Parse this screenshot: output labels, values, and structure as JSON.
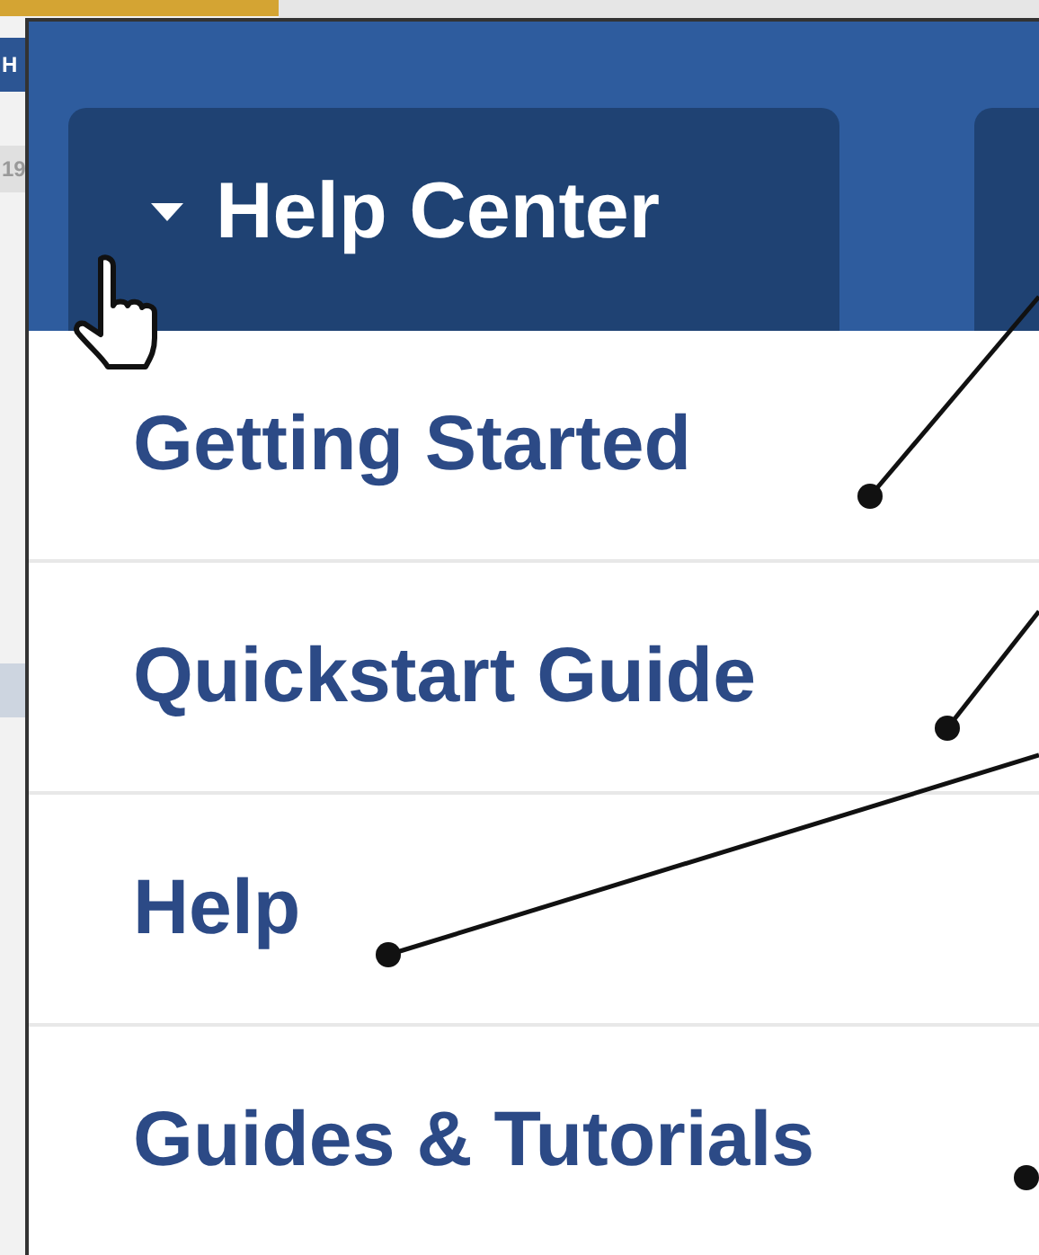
{
  "background_window": {
    "fragments": [
      "H",
      "19"
    ]
  },
  "menu": {
    "title": "Help Center",
    "expanded": true,
    "items": [
      {
        "label": "Getting Started"
      },
      {
        "label": "Quickstart Guide"
      },
      {
        "label": "Help"
      },
      {
        "label": "Guides & Tutorials"
      }
    ]
  }
}
